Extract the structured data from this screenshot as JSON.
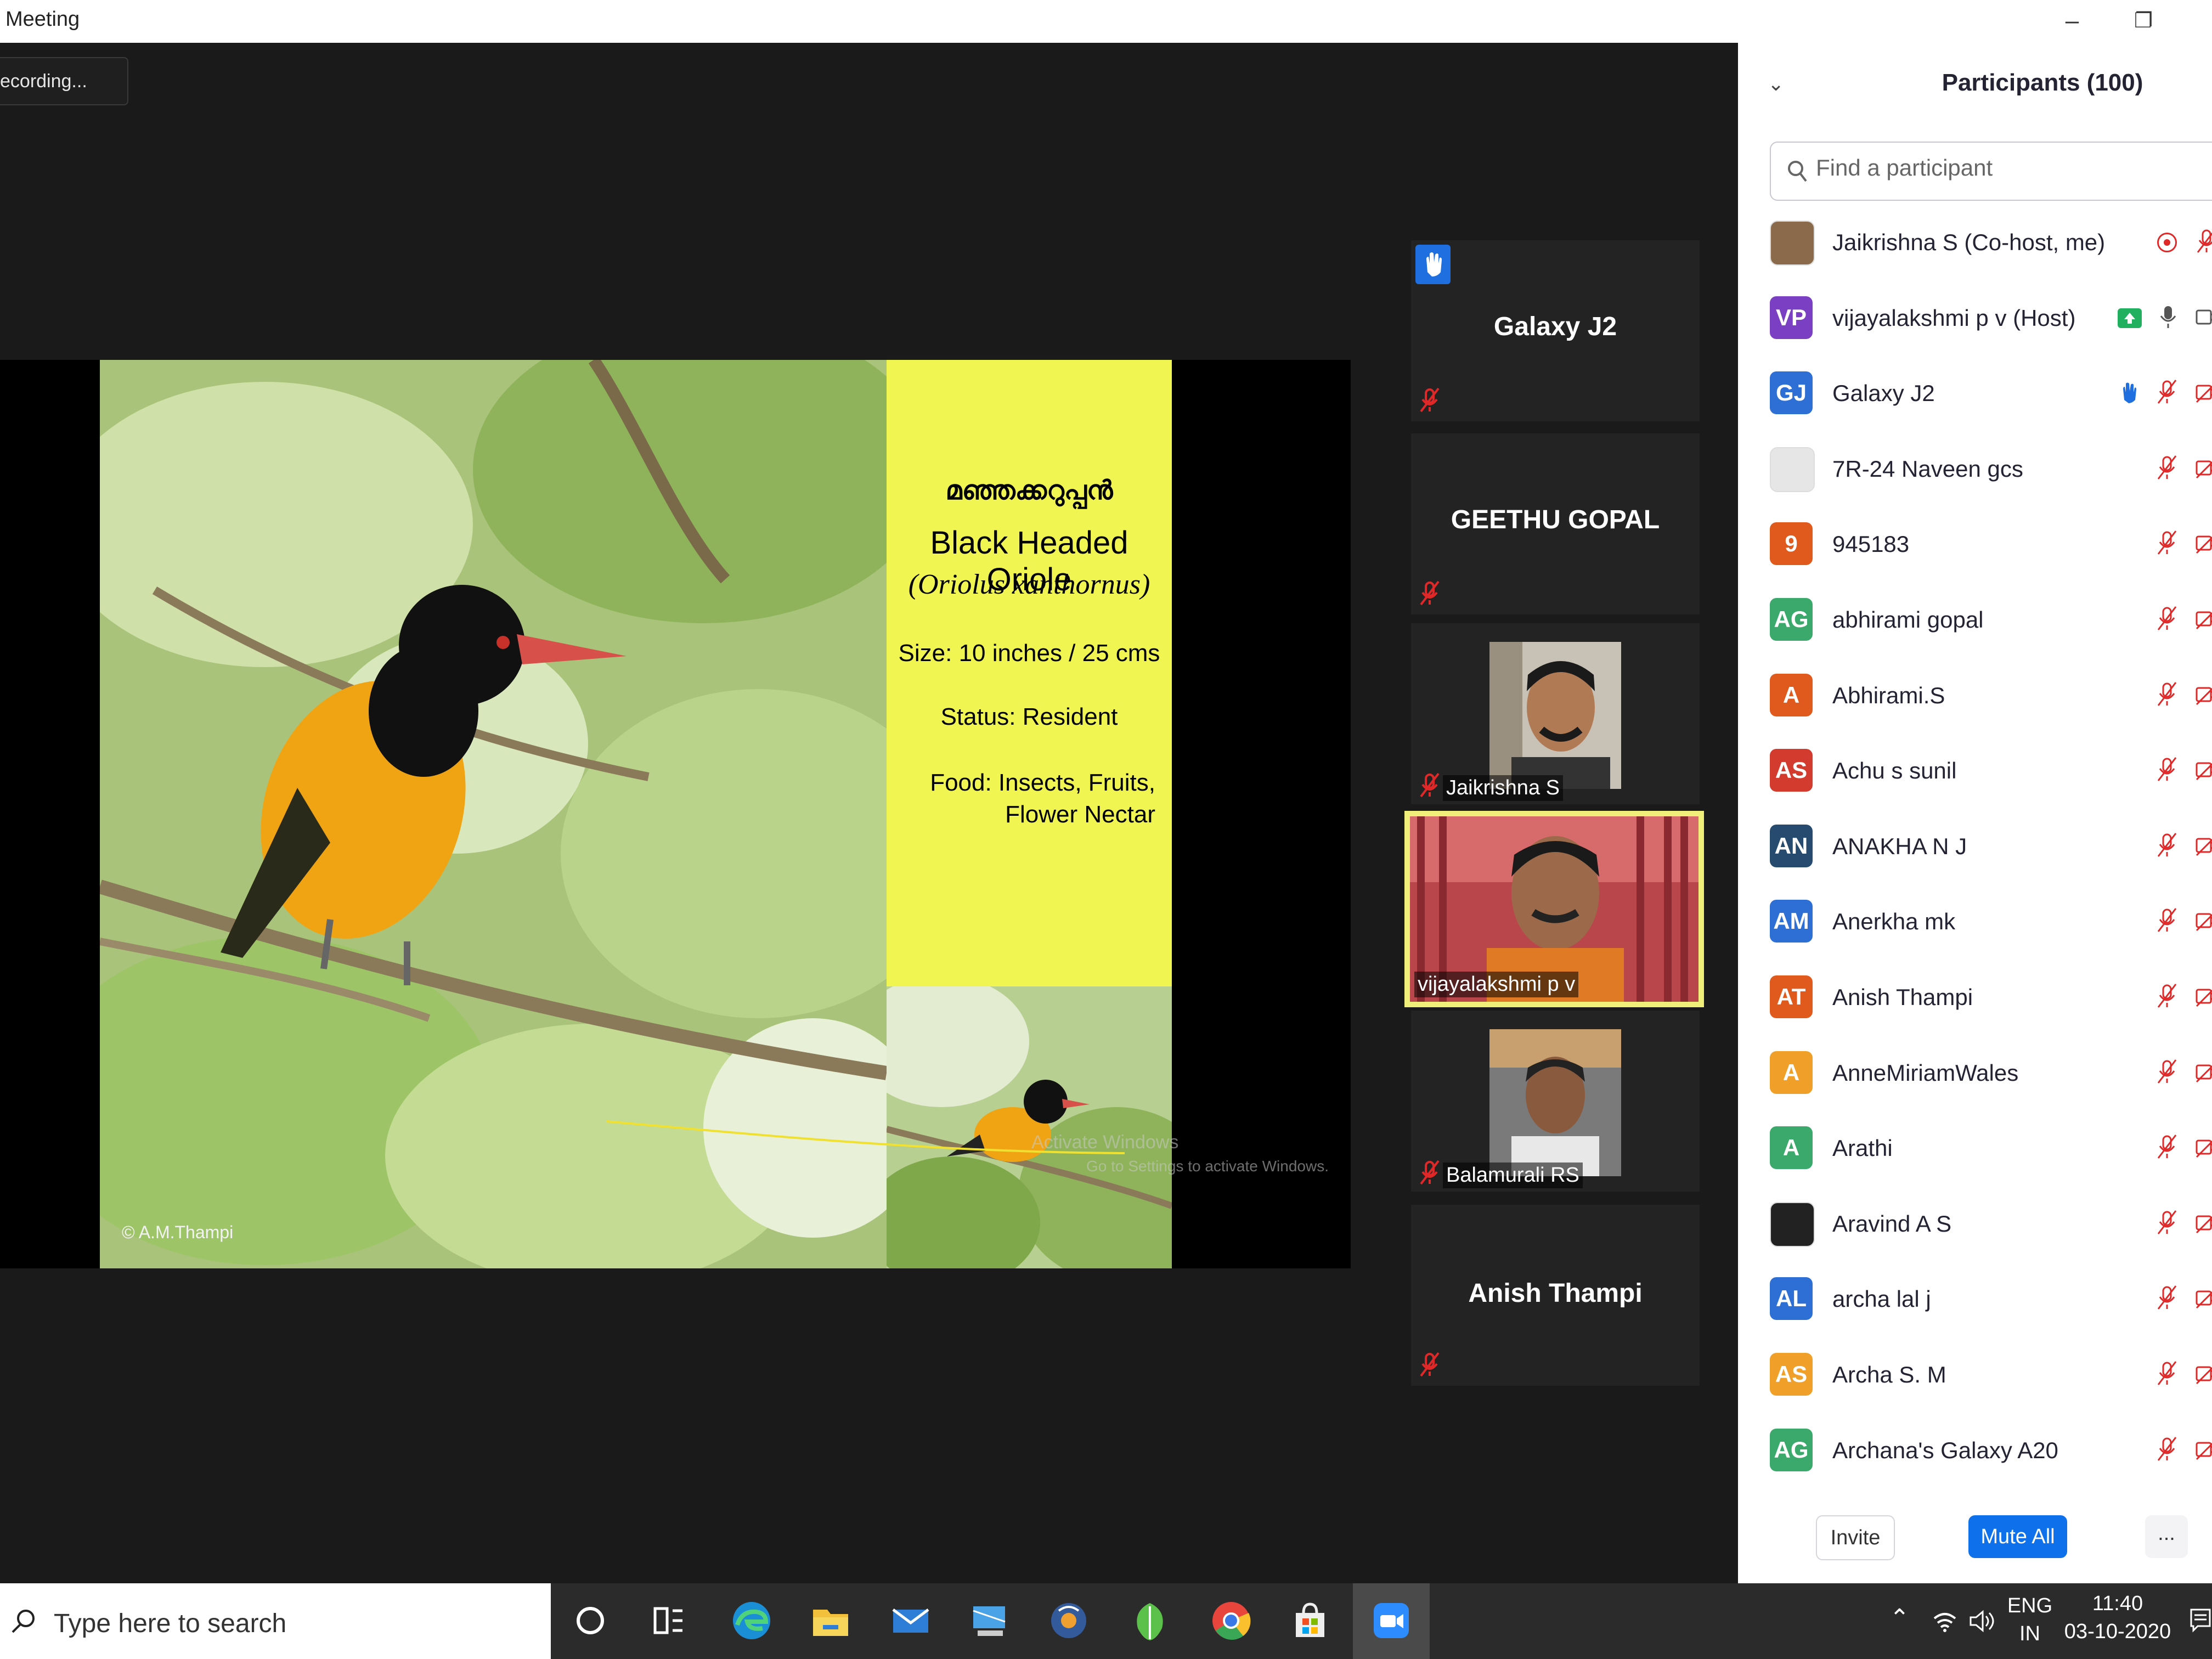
{
  "window": {
    "title": "Meeting",
    "minimize": "–",
    "restore": "❐"
  },
  "recording": {
    "label": "ecording..."
  },
  "slide": {
    "malayalam_name": "മഞ്ഞക്കറുപ്പൻ",
    "common_name": "Black Headed Oriole",
    "scientific_name": "(Oriolus xanthornus)",
    "size": "Size: 10 inches / 25 cms",
    "status": "Status: Resident",
    "food_line1": "Food: Insects, Fruits,",
    "food_line2": "Flower Nectar",
    "copyright": "© A.M.Thampi",
    "watermark_line1": "Activate Windows",
    "watermark_line2": "Go to Settings to activate Windows."
  },
  "tiles": [
    {
      "name": "Galaxy J2",
      "hand_raised": true
    },
    {
      "name": "GEETHU GOPAL"
    },
    {
      "name": "Jaikrishna S"
    },
    {
      "name": "vijayalakshmi p v",
      "active_speaker": true
    },
    {
      "name": "Balamurali RS"
    },
    {
      "name": "Anish Thampi"
    }
  ],
  "participants": {
    "title": "Participants (100)",
    "search_placeholder": "Find a participant",
    "list": [
      {
        "initials": "",
        "name": "Jaikrishna S (Co-host, me)",
        "color": "#8a6a4a",
        "photo": true
      },
      {
        "initials": "VP",
        "name": "vijayalakshmi p v (Host)",
        "color": "#7b3fc4"
      },
      {
        "initials": "GJ",
        "name": "Galaxy J2",
        "color": "#2e6fd6"
      },
      {
        "initials": "",
        "name": "7R-24 Naveen gcs",
        "color": "#e6e6e6",
        "photo": true
      },
      {
        "initials": "9",
        "name": "945183",
        "color": "#e05a1e"
      },
      {
        "initials": "AG",
        "name": "abhirami gopal",
        "color": "#3aa96b"
      },
      {
        "initials": "A",
        "name": "Abhirami.S",
        "color": "#e05a1e"
      },
      {
        "initials": "AS",
        "name": "Achu s sunil",
        "color": "#d43b2f"
      },
      {
        "initials": "AN",
        "name": "ANAKHA N J",
        "color": "#264b6e"
      },
      {
        "initials": "AM",
        "name": "Anerkha mk",
        "color": "#2e6fd6"
      },
      {
        "initials": "AT",
        "name": "Anish Thampi",
        "color": "#e05a1e"
      },
      {
        "initials": "A",
        "name": "AnneMiriamWales",
        "color": "#f0a028"
      },
      {
        "initials": "A",
        "name": "Arathi",
        "color": "#3aa96b"
      },
      {
        "initials": "",
        "name": "Aravind A S",
        "color": "#222222",
        "photo": true
      },
      {
        "initials": "AL",
        "name": "archa lal j",
        "color": "#2e6fd6"
      },
      {
        "initials": "AS",
        "name": "Archa S. M",
        "color": "#f0a028"
      },
      {
        "initials": "AG",
        "name": "Archana's Galaxy A20",
        "color": "#3aa96b"
      }
    ],
    "invite": "Invite",
    "mute_all": "Mute All",
    "more": "..."
  },
  "taskbar": {
    "search_placeholder": "Type here to search",
    "lang_top": "ENG",
    "lang_bottom": "IN",
    "time": "11:40",
    "date": "03-10-2020"
  }
}
